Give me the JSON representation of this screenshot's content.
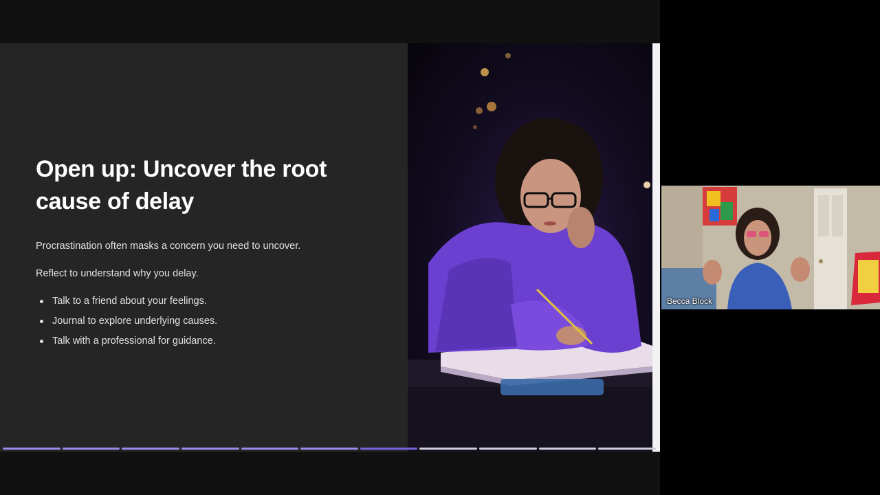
{
  "slide": {
    "title": "Open up: Uncover the root cause of delay",
    "paragraphs": [
      "Procrastination often masks a concern you need to uncover.",
      "Reflect to understand why you delay."
    ],
    "bullets": [
      "Talk to a friend about your feelings.",
      "Journal to explore underlying causes.",
      "Talk with a professional for guidance."
    ],
    "image_icon": "woman-journaling-photo"
  },
  "progress": {
    "total_slides": 11,
    "current_slide": 7
  },
  "video": {
    "participant_name": "Becca Block"
  },
  "colors": {
    "slide_background": "#252525",
    "progress_done": "#9a8be8",
    "progress_current": "#7a64e0",
    "progress_remaining": "#cfcfe0"
  }
}
